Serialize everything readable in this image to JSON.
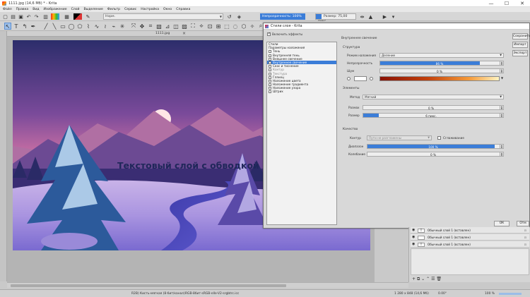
{
  "window": {
    "title": "1111.jpg (14,6 Мб)  *  - Krita",
    "controls": [
      "—",
      "☐",
      "✕"
    ]
  },
  "menu": [
    "Файл",
    "Правка",
    "Вид",
    "Изображение",
    "Слой",
    "Выделение",
    "Фильтр",
    "Сервис",
    "Настройка",
    "Окно",
    "Справка"
  ],
  "toolbar": {
    "blend_mode": "Норм.",
    "opacity_label": "Непрозрачность: 100%",
    "size_label": "Размер: 75,00 пикс."
  },
  "document": {
    "tab_name": "1111.jpg",
    "canvas_text": "Текстовый слой с обводкой"
  },
  "dialog": {
    "title": "Стили слоя - Krita",
    "enable_effects": "Включить эффекты",
    "style_list": [
      {
        "label": "Стили",
        "check": false,
        "selected": false,
        "dim": false
      },
      {
        "label": "Параметры наложения",
        "check": false,
        "selected": false,
        "dim": false
      },
      {
        "label": "Тень",
        "check": true,
        "selected": false,
        "dim": false
      },
      {
        "label": "Внутренняя тень",
        "check": true,
        "selected": false,
        "dim": false
      },
      {
        "label": "Внешнее свечение",
        "check": true,
        "selected": false,
        "dim": false
      },
      {
        "label": "Внутреннее свечение",
        "check": true,
        "selected": true,
        "dim": false
      },
      {
        "label": "Скос и тиснение",
        "check": true,
        "selected": false,
        "dim": false
      },
      {
        "label": "Контур",
        "check": true,
        "selected": false,
        "dim": true
      },
      {
        "label": "Текстура",
        "check": true,
        "selected": false,
        "dim": true
      },
      {
        "label": "Глянец",
        "check": true,
        "selected": false,
        "dim": false
      },
      {
        "label": "Наложение цвета",
        "check": true,
        "selected": false,
        "dim": false
      },
      {
        "label": "Наложение градиента",
        "check": true,
        "selected": false,
        "dim": false
      },
      {
        "label": "Наложение узора",
        "check": true,
        "selected": false,
        "dim": false
      },
      {
        "label": "Штрих",
        "check": true,
        "selected": false,
        "dim": false
      }
    ],
    "panel": {
      "heading": "Внутреннее свечение",
      "structure": {
        "title": "Структура",
        "blend_label": "Режим наложения",
        "blend_value": "Деление",
        "opacity_label": "Непрозрачность",
        "opacity_value": "86 %",
        "opacity_fraction": 0.86,
        "noise_label": "Шум",
        "noise_value": "0 %"
      },
      "elements": {
        "title": "Элементы",
        "method_label": "Метод",
        "method_value": "Мягкий",
        "range_label": "Размах",
        "range_value": "0 %",
        "size_label": "Размер",
        "size_value": "6 пикс.",
        "size_fraction": 0.12
      },
      "quality": {
        "title": "Качество",
        "contour_label": "Контур",
        "contour_value": "Пути не разглажены",
        "antialias_label": "Сглаживание",
        "range_label": "Диапазон",
        "range_value": "100 %",
        "range_fraction": 1.0,
        "jitter_label": "Колебание",
        "jitter_value": "0 %"
      }
    },
    "buttons": {
      "save": "Сохранить",
      "import": "Импорт",
      "export": "Экспорт",
      "ok": "ОК",
      "cancel": "Отм"
    }
  },
  "layers": [
    {
      "name": "Обычный слой 1 (вставлен)",
      "thumb": "T"
    },
    {
      "name": "Обычный слой 1 (вставлен)",
      "thumb": ""
    },
    {
      "name": "Обычный слой 1 (вставлен)",
      "thumb": "T"
    }
  ],
  "status": {
    "brush": "R2B) Кисть-мягкая (8-бит/канал) ",
    "colorspace": "RGB-8бит-sRGB-elle-V2-srgbtrc.icc",
    "size": "1 280 х 848 (14,6 Мб)",
    "angle": "0.00°",
    "zoom": "100 %"
  },
  "colors": {
    "accent": "#3b7dd8",
    "canvas_text": "#20275a"
  }
}
